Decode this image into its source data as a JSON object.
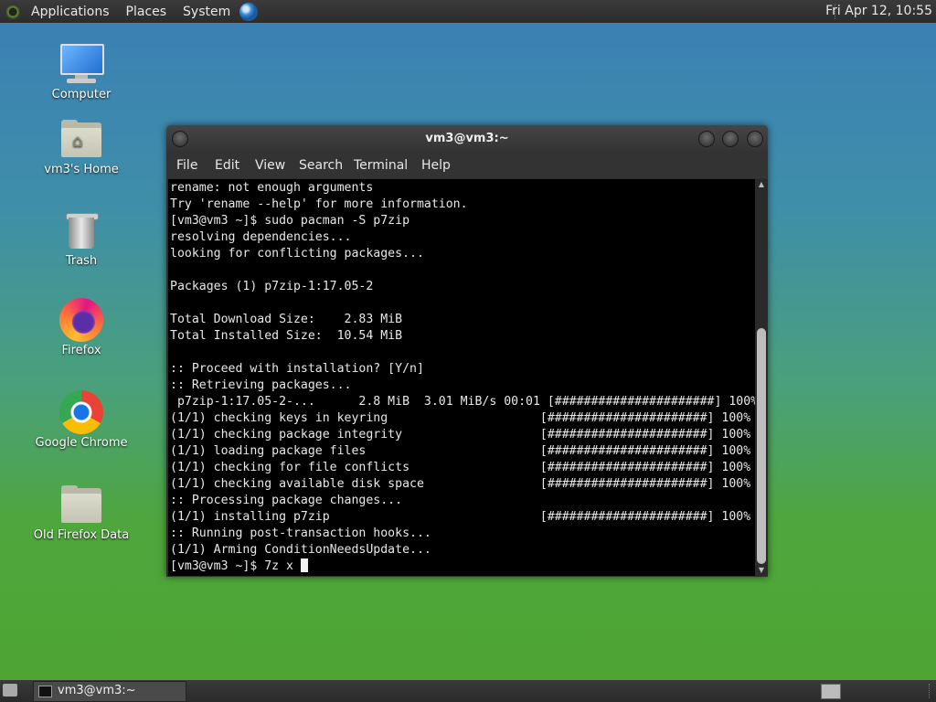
{
  "top_panel": {
    "menus": [
      "Applications",
      "Places",
      "System"
    ],
    "clock": "Fri Apr 12, 10:55"
  },
  "desktop": {
    "icons": [
      {
        "label": "Computer",
        "icon": "computer-icon"
      },
      {
        "label": "vm3's Home",
        "icon": "home-folder-icon"
      },
      {
        "label": "Trash",
        "icon": "trash-icon"
      },
      {
        "label": "Firefox",
        "icon": "firefox-icon"
      },
      {
        "label": "Google Chrome",
        "icon": "chrome-icon"
      },
      {
        "label": "Old Firefox Data",
        "icon": "folder-icon"
      }
    ]
  },
  "terminal": {
    "title": "vm3@vm3:~",
    "menus": [
      "File",
      "Edit",
      "View",
      "Search",
      "Terminal",
      "Help"
    ],
    "lines": [
      "rename: not enough arguments",
      "Try 'rename --help' for more information.",
      "[vm3@vm3 ~]$ sudo pacman -S p7zip",
      "resolving dependencies...",
      "looking for conflicting packages...",
      "",
      "Packages (1) p7zip-1:17.05-2",
      "",
      "Total Download Size:    2.83 MiB",
      "Total Installed Size:  10.54 MiB",
      "",
      ":: Proceed with installation? [Y/n]",
      ":: Retrieving packages...",
      " p7zip-1:17.05-2-...      2.8 MiB  3.01 MiB/s 00:01 [######################] 100%",
      "(1/1) checking keys in keyring                     [######################] 100%",
      "(1/1) checking package integrity                   [######################] 100%",
      "(1/1) loading package files                        [######################] 100%",
      "(1/1) checking for file conflicts                  [######################] 100%",
      "(1/1) checking available disk space                [######################] 100%",
      ":: Processing package changes...",
      "(1/1) installing p7zip                             [######################] 100%",
      ":: Running post-transaction hooks...",
      "(1/1) Arming ConditionNeedsUpdate..."
    ],
    "prompt": "[vm3@vm3 ~]$ 7z x "
  },
  "taskbar": {
    "window_button": "vm3@vm3:~"
  }
}
